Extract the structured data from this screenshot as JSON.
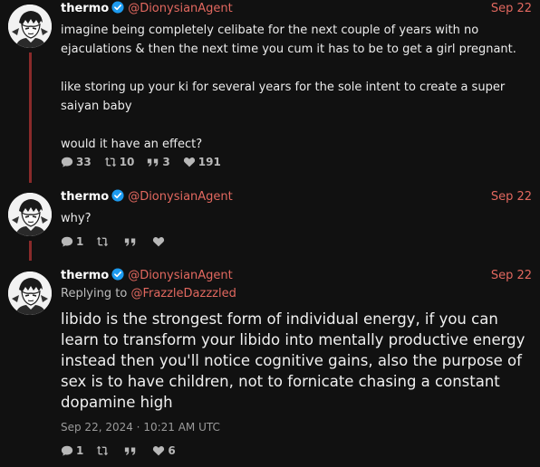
{
  "tweets": [
    {
      "author": "thermo",
      "handle": "@DionysianAgent",
      "date": "Sep 22",
      "lines": [
        "imagine being completely celibate for the next couple of years with no",
        "ejaculations & then the next time you cum it has to be to get a girl pregnant.",
        "",
        "like storing up your ki for several years for the sole intent to create a super",
        "saiyan baby",
        "",
        "would it have an effect?"
      ],
      "stats": {
        "replies": "33",
        "retweets": "10",
        "quotes": "3",
        "likes": "191"
      }
    },
    {
      "author": "thermo",
      "handle": "@DionysianAgent",
      "date": "Sep 22",
      "text": "why?",
      "stats": {
        "replies": "1",
        "retweets": "",
        "quotes": "",
        "likes": ""
      }
    },
    {
      "author": "thermo",
      "handle": "@DionysianAgent",
      "date": "Sep 22",
      "replying_prefix": "Replying to",
      "replying_handle": "@FrazzleDazzzled",
      "text": "libido is the strongest form of individual energy, if you can learn to transform your libido into mentally productive energy instead then you'll notice cognitive gains, also the purpose of sex is to have children, not to fornicate chasing a constant dopamine high",
      "timestamp": "Sep 22, 2024 · 10:21 AM UTC",
      "stats": {
        "replies": "1",
        "retweets": "",
        "quotes": "",
        "likes": "6"
      }
    }
  ],
  "icons": {
    "avatar": "manga-character-avatar",
    "verified": "verified-badge-icon",
    "reply": "comment-icon",
    "retweet": "retweet-icon",
    "quote": "quote-icon",
    "like": "heart-icon"
  },
  "colors": {
    "background": "#111111",
    "handle": "#e2685f",
    "thread_line": "#8a2a2a",
    "verified": "#1d9bf0"
  }
}
